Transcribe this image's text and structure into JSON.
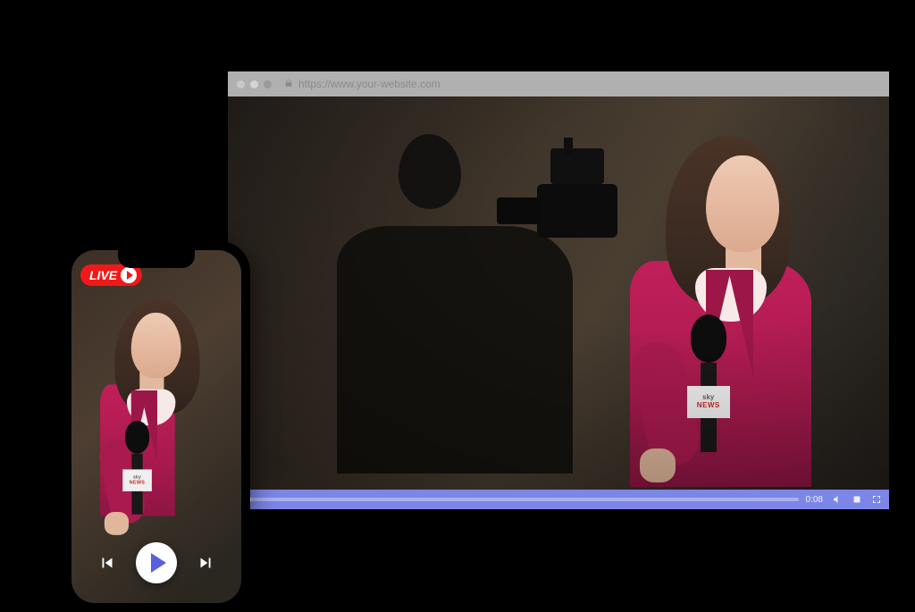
{
  "browser": {
    "url": "https://www.your-website.com",
    "player": {
      "elapsed": "0:08",
      "progress_pct": 2
    }
  },
  "phone": {
    "live_label": "LIVE"
  },
  "mic_flag": {
    "brand": "sky",
    "line2": "NEWS"
  }
}
